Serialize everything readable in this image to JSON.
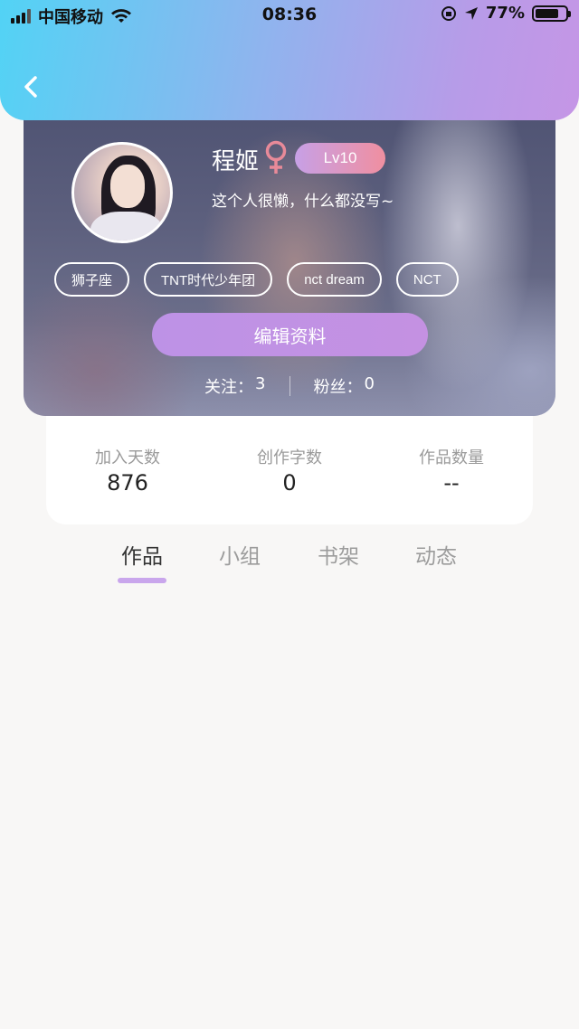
{
  "status_bar": {
    "carrier": "中国移动",
    "time": "08:36",
    "battery": "77%",
    "battery_level": 0.77
  },
  "header": {
    "back_icon": "chevron-left-icon"
  },
  "profile": {
    "nickname": "程姬",
    "gender_icon": "female-icon",
    "gender_color": "#e88a99",
    "level": "Lv10",
    "bio": "这个人很懒，什么都没写~",
    "tags": [
      "狮子座",
      "TNT时代少年团",
      "nct dream",
      "NCT"
    ],
    "edit_button": "编辑资料",
    "following_label": "关注：",
    "following_count": "3",
    "followers_label": "粉丝：",
    "followers_count": "0"
  },
  "stats": [
    {
      "label": "加入天数",
      "value": "876"
    },
    {
      "label": "创作字数",
      "value": "0"
    },
    {
      "label": "作品数量",
      "value": "--"
    }
  ],
  "tabs": [
    {
      "label": "作品",
      "active": true
    },
    {
      "label": "小组",
      "active": false
    },
    {
      "label": "书架",
      "active": false
    },
    {
      "label": "动态",
      "active": false
    }
  ],
  "colors": {
    "accent": "#c9a6ec",
    "header_gradient_start": "#52d3f5",
    "header_gradient_end": "#c596e6",
    "background": "#f8f7f6"
  }
}
